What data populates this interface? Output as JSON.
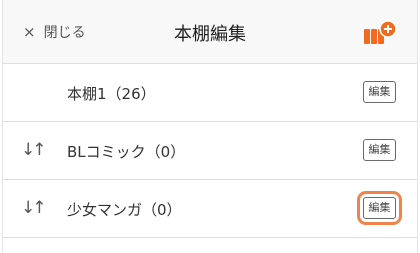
{
  "header": {
    "close_icon": "×",
    "close_label": "閉じる",
    "title": "本棚編集",
    "add_icon": "add-bookshelf-icon",
    "accent_color": "#f26a1b"
  },
  "shelves": [
    {
      "name": "本棚1（26）",
      "reorderable": false,
      "edit_label": "編集"
    },
    {
      "name": "BLコミック（0）",
      "reorderable": true,
      "handle": "↓↑",
      "edit_label": "編集"
    },
    {
      "name": "少女マンガ（0）",
      "reorderable": true,
      "handle": "↓↑",
      "edit_label": "編集",
      "highlighted": true
    }
  ],
  "highlight_color": "#f0824a"
}
